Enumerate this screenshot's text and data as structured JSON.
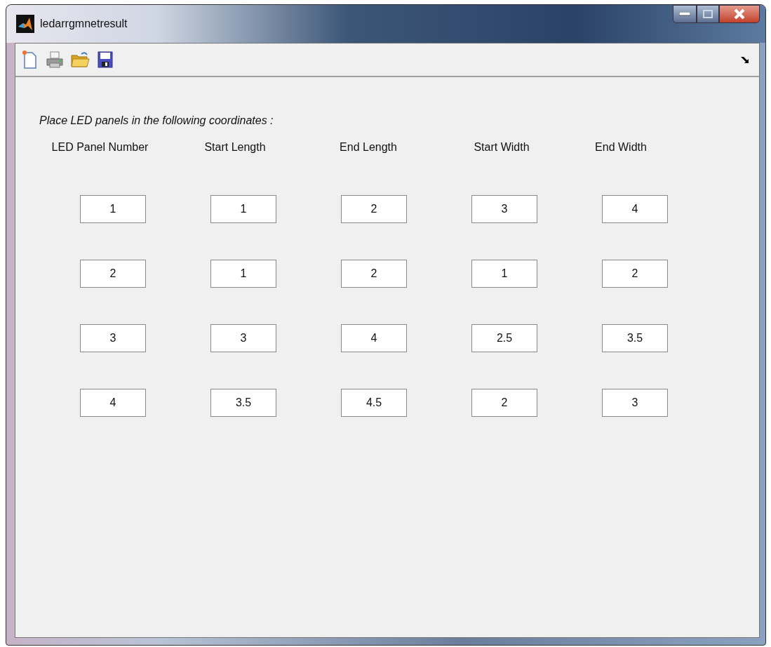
{
  "window": {
    "title": "ledarrgmnetresult"
  },
  "toolbar": {
    "tools": [
      {
        "kind": "new"
      },
      {
        "kind": "print"
      },
      {
        "kind": "open"
      },
      {
        "kind": "save"
      }
    ]
  },
  "instruction": "Place LED  panels in the following  coordinates :",
  "table": {
    "columns": [
      "LED  Panel  Number",
      "Start  Length",
      "End Length",
      "Start  Width",
      "End Width"
    ],
    "rows": [
      [
        "1",
        "1",
        "2",
        "3",
        "4"
      ],
      [
        "2",
        "1",
        "2",
        "1",
        "2"
      ],
      [
        "3",
        "3",
        "4",
        "2.5",
        "3.5"
      ],
      [
        "4",
        "3.5",
        "4.5",
        "2",
        "3"
      ]
    ]
  }
}
